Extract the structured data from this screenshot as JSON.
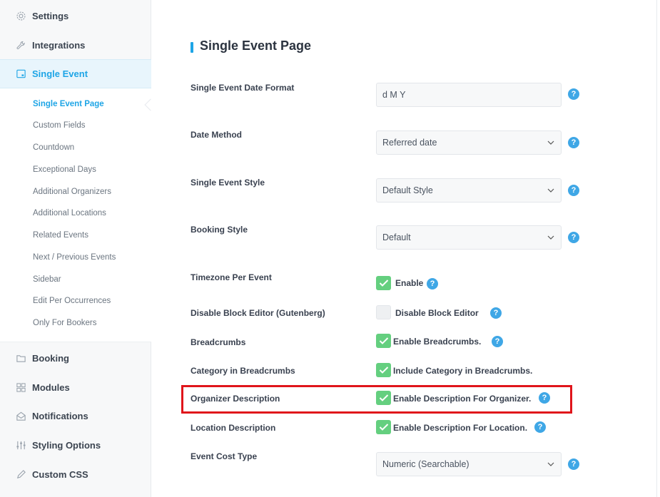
{
  "sidebar": {
    "items": [
      {
        "label": "Settings",
        "icon": "gear-icon"
      },
      {
        "label": "Integrations",
        "icon": "wrench-icon"
      },
      {
        "label": "Single Event",
        "icon": "calendar-icon"
      },
      {
        "label": "Booking",
        "icon": "folder-icon"
      },
      {
        "label": "Modules",
        "icon": "grid-icon"
      },
      {
        "label": "Notifications",
        "icon": "envelope-icon"
      },
      {
        "label": "Styling Options",
        "icon": "sliders-icon"
      },
      {
        "label": "Custom CSS",
        "icon": "pencil-icon"
      }
    ],
    "sub_items": [
      "Single Event Page",
      "Custom Fields",
      "Countdown",
      "Exceptional Days",
      "Additional Organizers",
      "Additional Locations",
      "Related Events",
      "Next / Previous Events",
      "Sidebar",
      "Edit Per Occurrences",
      "Only For Bookers"
    ]
  },
  "main": {
    "title": "Single Event Page",
    "date_format": {
      "label": "Single Event Date Format",
      "value": "d M Y"
    },
    "date_method": {
      "label": "Date Method",
      "value": "Referred date"
    },
    "event_style": {
      "label": "Single Event Style",
      "value": "Default Style"
    },
    "booking_style": {
      "label": "Booking Style",
      "value": "Default"
    },
    "timezone": {
      "label": "Timezone Per Event",
      "option": "Enable",
      "checked": true
    },
    "block_editor": {
      "label": "Disable Block Editor (Gutenberg)",
      "option": "Disable Block Editor",
      "checked": false
    },
    "breadcrumbs": {
      "label": "Breadcrumbs",
      "option": "Enable Breadcrumbs.",
      "checked": true
    },
    "category_breadcrumbs": {
      "label": "Category in Breadcrumbs",
      "option": "Include Category in Breadcrumbs.",
      "checked": true
    },
    "organizer_desc": {
      "label": "Organizer Description",
      "option": "Enable Description For Organizer.",
      "checked": true
    },
    "location_desc": {
      "label": "Location Description",
      "option": "Enable Description For Location.",
      "checked": true
    },
    "cost_type": {
      "label": "Event Cost Type",
      "value": "Numeric (Searchable)"
    },
    "help_glyph": "?"
  },
  "colors": {
    "accent": "#1ea5e6",
    "check": "#64cf7f",
    "help": "#3fa7e6",
    "highlight": "#e0151b"
  }
}
